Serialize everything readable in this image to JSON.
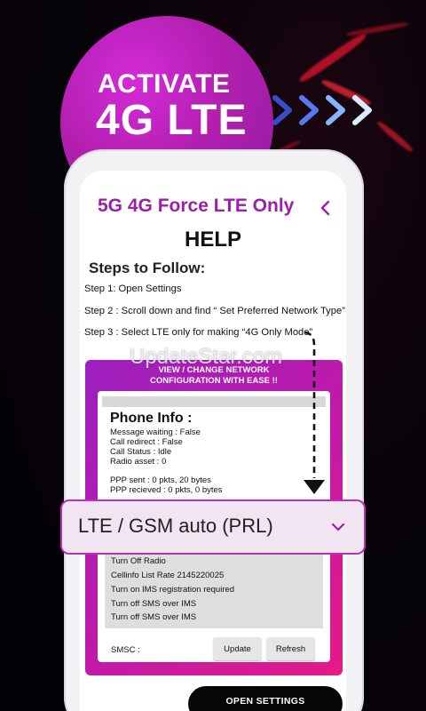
{
  "promo": {
    "line1": "ACTIVATE",
    "line2": "4G LTE"
  },
  "app": {
    "title": "5G 4G Force LTE Only",
    "back_icon": "chevron-left-icon",
    "accent": "#9b1fa7"
  },
  "help": {
    "title": "HELP",
    "steps_heading": "Steps to Follow:",
    "steps": [
      "Step 1: Open Settings",
      "Step 2 : Scroll down and find “ Set Preferred Network Type”",
      "Step 3 : Select LTE only for making “4G Only Mode”"
    ]
  },
  "card": {
    "header_line1": "VIEW / CHANGE NETWORK",
    "header_line2": "CONFIGURATION WITH EASE !!",
    "phone_info_title": "Phone Info :",
    "info_lines": [
      "Message waiting : False",
      "Call redirect : False",
      "Call Status : Idle",
      "Radio asset : 0"
    ],
    "ppp_lines": [
      "PPP sent : 0 pkts, 20 bytes",
      "PPP recieved : 0 pkts, 0 bytes"
    ],
    "menu_items": [
      "Turn Off Radio",
      "Cellinfo List Rate 2145220025",
      "Turn on IMS  registration required",
      "Turn off SMS over IMS",
      "Turn off SMS over IMS"
    ],
    "smsc_label": "SMSC :",
    "update_label": "Update",
    "refresh_label": "Refresh"
  },
  "dropdown": {
    "selected": "LTE / GSM auto (PRL)",
    "icon": "chevron-down-icon"
  },
  "watermark": "UpdateStar.com",
  "open_settings_label": "OPEN SETTINGS",
  "colors": {
    "promo_circle": "#b11fae",
    "card_gradient_start": "#9b1fbf",
    "card_gradient_end": "#e51a86",
    "dropdown_border": "#c22dba"
  }
}
